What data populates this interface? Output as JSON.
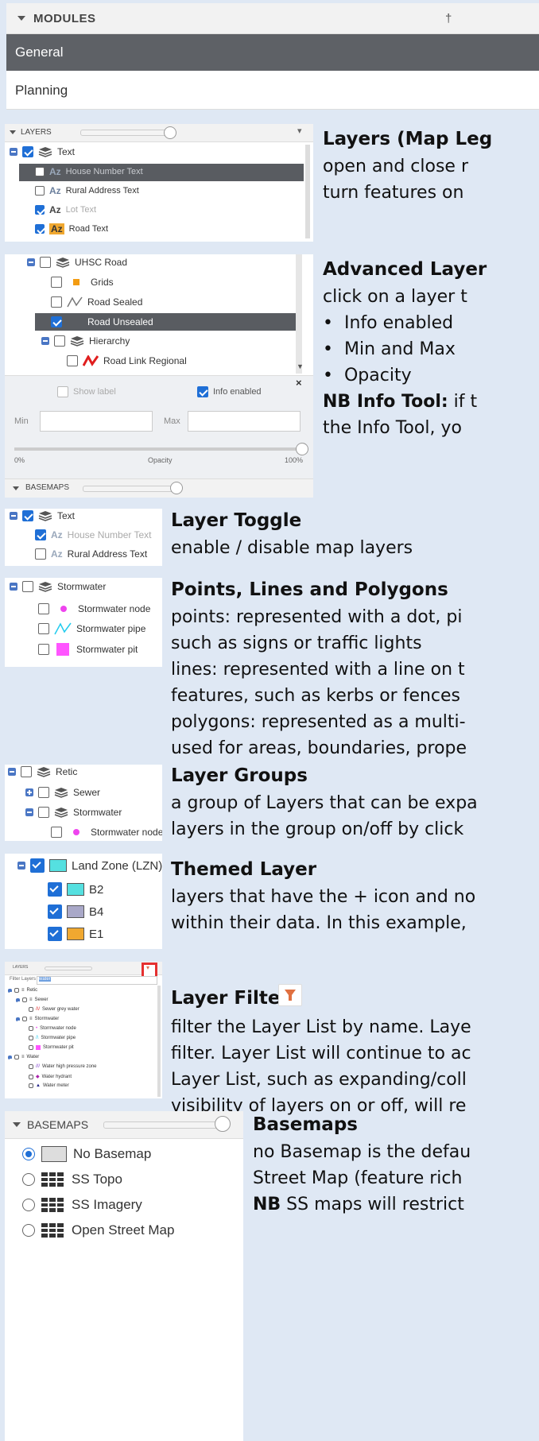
{
  "modules": {
    "title": "MODULES",
    "items": [
      "General",
      "Planning"
    ]
  },
  "layers_panel": {
    "title": "LAYERS",
    "items": [
      {
        "label": "Text",
        "checked": true
      },
      {
        "label": "House Number Text",
        "checked": false
      },
      {
        "label": "Rural Address Text",
        "checked": false
      },
      {
        "label": "Lot Text",
        "checked": true
      },
      {
        "label": "Road Text",
        "checked": true
      }
    ]
  },
  "advanced_panel": {
    "items": [
      "UHSC Road",
      "Grids",
      "Road Sealed",
      "Road Unsealed",
      "Hierarchy",
      "Road Link Regional"
    ],
    "show_label": "Show label",
    "info_enabled": "Info enabled",
    "min_label": "Min",
    "max_label": "Max",
    "opacity_min": "0%",
    "opacity_label": "Opacity",
    "opacity_max": "100%",
    "basemaps_title": "BASEMAPS"
  },
  "toggle_panel": {
    "items": [
      "Text",
      "House Number Text",
      "Rural Address Text"
    ]
  },
  "stormwater_panel": {
    "items": [
      "Stormwater",
      "Stormwater node",
      "Stormwater pipe",
      "Stormwater pit"
    ]
  },
  "groups_panel": {
    "items": [
      "Retic",
      "Sewer",
      "Stormwater",
      "Stormwater node"
    ]
  },
  "themed_panel": {
    "items": [
      "Land Zone (LZN)",
      "B2",
      "B4",
      "E1"
    ]
  },
  "filter_panel": {
    "title": "LAYERS",
    "filter_label": "Filter Layers",
    "filter_value": "water",
    "items": [
      "Retic",
      "Sewer",
      "Sewer grey water",
      "Stormwater",
      "Stormwater node",
      "Stormwater pipe",
      "Stormwater pit",
      "Water",
      "Water high pressure zone",
      "Water hydrant",
      "Water meter"
    ]
  },
  "basemaps_panel": {
    "title": "BASEMAPS",
    "options": [
      "No Basemap",
      "SS Topo",
      "SS Imagery",
      "Open Street Map"
    ]
  },
  "descriptions": {
    "layers_title": "Layers (Map Leg",
    "layers_lines": [
      "open and close r",
      "turn features on"
    ],
    "advanced_title": "Advanced Layer",
    "advanced_line": "click on a layer t",
    "advanced_bullets": [
      "Info enabled",
      "Min and Max",
      "Opacity"
    ],
    "nb_info_bold": "NB Info Tool:",
    "nb_info_rest": " if t",
    "nb_info_line2": "the Info Tool, yo",
    "toggle_title": "Layer Toggle",
    "toggle_line": "enable / disable map layers",
    "plp_title": "Points, Lines and Polygons",
    "plp_lines": [
      "points: represented with a dot, pi",
      "such as signs or traffic lights",
      "lines: represented with a line on t",
      "features, such as kerbs or fences",
      "polygons: represented as a multi-",
      "used for areas, boundaries, prope"
    ],
    "groups_title": "Layer Groups",
    "groups_lines": [
      "a group of Layers that can be expa",
      "layers in the group on/off by click"
    ],
    "themed_title": "Themed Layer",
    "themed_lines": [
      "layers that have the + icon and no",
      "within their data. In this example,"
    ],
    "filter_title": "Layer Filter",
    "filter_lines": [
      "filter the Layer List by name. Laye",
      "filter. Layer List will continue to ac",
      "Layer List, such as expanding/coll",
      "visibility of layers on or off, will re"
    ],
    "basemaps_title": "Basemaps",
    "basemaps_lines": [
      "no Basemap is the defau",
      "Street Map (feature rich"
    ],
    "basemaps_nb_bold": "NB",
    "basemaps_nb_rest": " SS maps will restrict"
  },
  "colors": {
    "page_bg": "#dfe8f4",
    "module_selected_bg": "#5e6166",
    "selected_row_bg": "#595c61",
    "accent": "#1f6fd6",
    "filter_highlight": "#e53030"
  }
}
